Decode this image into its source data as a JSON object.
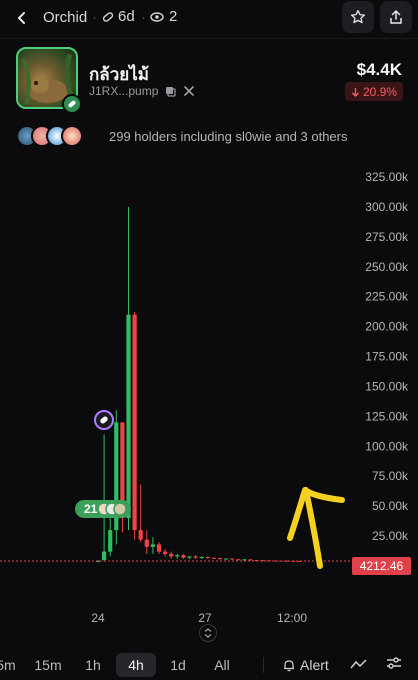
{
  "header": {
    "title": "Orchid",
    "age": "6d",
    "watchers": "2"
  },
  "token": {
    "name": "กล้วยไม้",
    "address": "J1RX...pump",
    "market_cap": "$4.4K",
    "change": "20.9%",
    "change_direction": "down"
  },
  "holders": {
    "text": "299 holders including sl0wie and 3 others"
  },
  "chart_data": {
    "type": "candlestick",
    "y_ticks": [
      "325.00k",
      "300.00k",
      "275.00k",
      "250.00k",
      "225.00k",
      "200.00k",
      "175.00k",
      "150.00k",
      "125.00k",
      "100.00k",
      "75.00k",
      "50.00k",
      "25.00k"
    ],
    "x_ticks": [
      "24",
      "27",
      "12:00"
    ],
    "current_price_label": "4212.46",
    "trade_marker_count": "21",
    "candles": [
      {
        "o": 4.2,
        "h": 5,
        "l": 3,
        "c": 4.2
      },
      {
        "o": 5,
        "h": 110,
        "l": 4,
        "c": 12
      },
      {
        "o": 12,
        "h": 40,
        "l": 8,
        "c": 30
      },
      {
        "o": 30,
        "h": 130,
        "l": 18,
        "c": 120
      },
      {
        "o": 120,
        "h": 118,
        "l": 28,
        "c": 40
      },
      {
        "o": 40,
        "h": 300,
        "l": 30,
        "c": 210
      },
      {
        "o": 210,
        "h": 212,
        "l": 22,
        "c": 30
      },
      {
        "o": 30,
        "h": 68,
        "l": 20,
        "c": 22
      },
      {
        "o": 22,
        "h": 30,
        "l": 10,
        "c": 16
      },
      {
        "o": 16,
        "h": 24,
        "l": 10,
        "c": 18
      },
      {
        "o": 18,
        "h": 20,
        "l": 10,
        "c": 12
      },
      {
        "o": 12,
        "h": 14,
        "l": 8,
        "c": 10
      },
      {
        "o": 10,
        "h": 12,
        "l": 6,
        "c": 8
      },
      {
        "o": 8,
        "h": 10,
        "l": 6,
        "c": 9
      },
      {
        "o": 9,
        "h": 10,
        "l": 6,
        "c": 7
      },
      {
        "o": 7,
        "h": 8,
        "l": 6,
        "c": 8
      },
      {
        "o": 8,
        "h": 9,
        "l": 6,
        "c": 7
      },
      {
        "o": 7,
        "h": 8,
        "l": 6,
        "c": 7.5
      },
      {
        "o": 7.5,
        "h": 8,
        "l": 6,
        "c": 6.8
      },
      {
        "o": 6.8,
        "h": 7.2,
        "l": 6,
        "c": 6.5
      },
      {
        "o": 6.5,
        "h": 7,
        "l": 5.5,
        "c": 6
      },
      {
        "o": 6,
        "h": 6.5,
        "l": 5.5,
        "c": 6.2
      },
      {
        "o": 6.2,
        "h": 6.4,
        "l": 5.2,
        "c": 5.6
      },
      {
        "o": 5.6,
        "h": 6,
        "l": 5,
        "c": 5.4
      },
      {
        "o": 5.4,
        "h": 5.8,
        "l": 5,
        "c": 5.5
      },
      {
        "o": 5.5,
        "h": 5.6,
        "l": 4.8,
        "c": 5
      },
      {
        "o": 5,
        "h": 5.2,
        "l": 4.6,
        "c": 4.9
      },
      {
        "o": 4.9,
        "h": 5,
        "l": 4.5,
        "c": 4.7
      },
      {
        "o": 4.7,
        "h": 4.8,
        "l": 4.4,
        "c": 4.6
      },
      {
        "o": 4.6,
        "h": 4.7,
        "l": 4.3,
        "c": 4.5
      },
      {
        "o": 4.5,
        "h": 4.6,
        "l": 4.2,
        "c": 4.4
      },
      {
        "o": 4.4,
        "h": 4.5,
        "l": 4.2,
        "c": 4.3
      },
      {
        "o": 4.3,
        "h": 4.4,
        "l": 4.1,
        "c": 4.25
      },
      {
        "o": 4.25,
        "h": 4.3,
        "l": 4.1,
        "c": 4.2
      }
    ],
    "colors": {
      "up": "#2fbf63",
      "down": "#ef4444",
      "price_line": "#e0414a"
    }
  },
  "timeframes": [
    "5m",
    "15m",
    "1h",
    "4h",
    "1d",
    "All"
  ],
  "active_timeframe": "4h",
  "toolbar": {
    "alert_label": "Alert"
  },
  "colors": {
    "accent_green": "#4ad07a",
    "negative": "#ff5a5f",
    "annotation_arrow": "#f5d020"
  }
}
